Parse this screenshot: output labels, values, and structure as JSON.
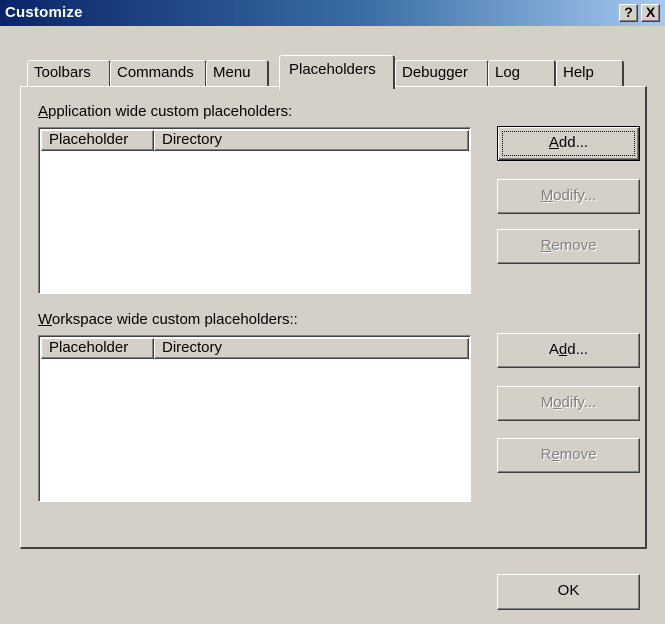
{
  "window": {
    "title": "Customize",
    "help_button": "?",
    "close_button": "X"
  },
  "tabs": [
    {
      "label": "Toolbars"
    },
    {
      "label": "Commands"
    },
    {
      "label": "Menu"
    },
    {
      "label": "Placeholders",
      "active": true
    },
    {
      "label": "Debugger"
    },
    {
      "label": "Log"
    },
    {
      "label": "Help"
    }
  ],
  "application_section": {
    "label_prefix": "A",
    "label_rest": "pplication wide custom placeholders:",
    "columns": [
      "Placeholder",
      "Directory"
    ],
    "rows": [],
    "buttons": {
      "add": {
        "mnemonic": "A",
        "rest": "dd...",
        "enabled": true
      },
      "modify": {
        "mnemonic": "M",
        "rest": "odify...",
        "enabled": false
      },
      "remove": {
        "mnemonic": "R",
        "rest": "emove",
        "enabled": false
      }
    }
  },
  "workspace_section": {
    "label_prefix": "W",
    "label_rest": "orkspace wide custom placeholders::",
    "columns": [
      "Placeholder",
      "Directory"
    ],
    "rows": [],
    "buttons": {
      "add": {
        "before": "A",
        "mnemonic": "d",
        "rest": "d...",
        "enabled": true
      },
      "modify": {
        "before": "M",
        "mnemonic": "o",
        "rest": "dify...",
        "enabled": false
      },
      "remove": {
        "before": "R",
        "mnemonic": "e",
        "rest": "move",
        "enabled": false
      }
    }
  },
  "footer": {
    "ok_label": "OK"
  }
}
